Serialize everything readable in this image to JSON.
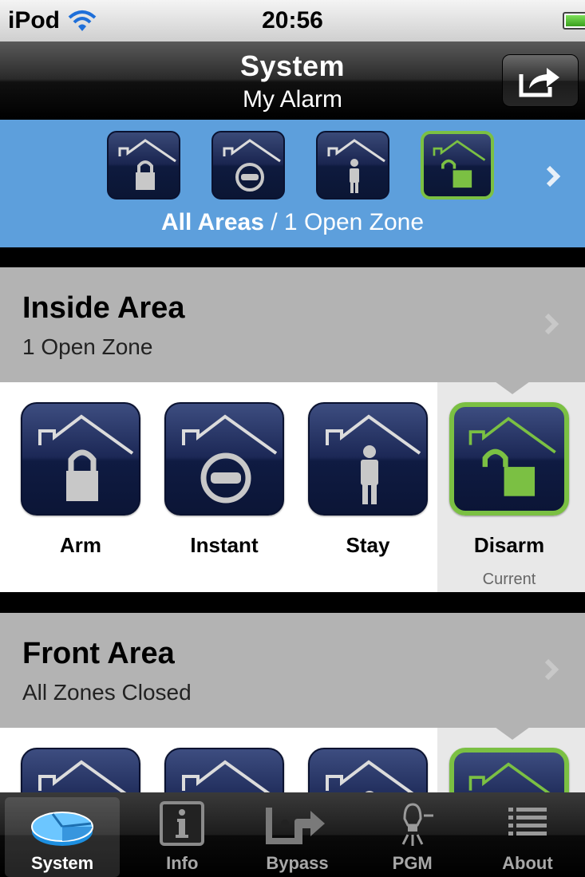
{
  "status_bar": {
    "carrier": "iPod",
    "time": "20:56",
    "wifi_icon": "wifi-icon",
    "battery_icon": "battery-icon"
  },
  "nav": {
    "title": "System",
    "subtitle": "My Alarm",
    "share_icon": "share-icon"
  },
  "summary": {
    "areas_label": "All Areas",
    "separator": " / ",
    "status": "1 Open Zone",
    "icons": [
      "arm-icon",
      "instant-icon",
      "stay-icon",
      "disarm-icon"
    ],
    "active": "disarm"
  },
  "areas": [
    {
      "title": "Inside Area",
      "status": "1 Open Zone",
      "modes": [
        {
          "label": "Arm",
          "icon": "arm-icon"
        },
        {
          "label": "Instant",
          "icon": "instant-icon"
        },
        {
          "label": "Stay",
          "icon": "stay-icon"
        },
        {
          "label": "Disarm",
          "icon": "disarm-icon",
          "sub": "Current"
        }
      ]
    },
    {
      "title": "Front Area",
      "status": "All Zones Closed"
    }
  ],
  "tabs": [
    {
      "label": "System",
      "icon": "system-disc-icon",
      "active": true
    },
    {
      "label": "Info",
      "icon": "info-icon"
    },
    {
      "label": "Bypass",
      "icon": "bypass-icon"
    },
    {
      "label": "PGM",
      "icon": "lightbulb-icon"
    },
    {
      "label": "About",
      "icon": "list-icon"
    }
  ],
  "colors": {
    "accent_green": "#7bc043",
    "summary_blue": "#5d9fdc",
    "icon_navy": "#1a2550"
  }
}
